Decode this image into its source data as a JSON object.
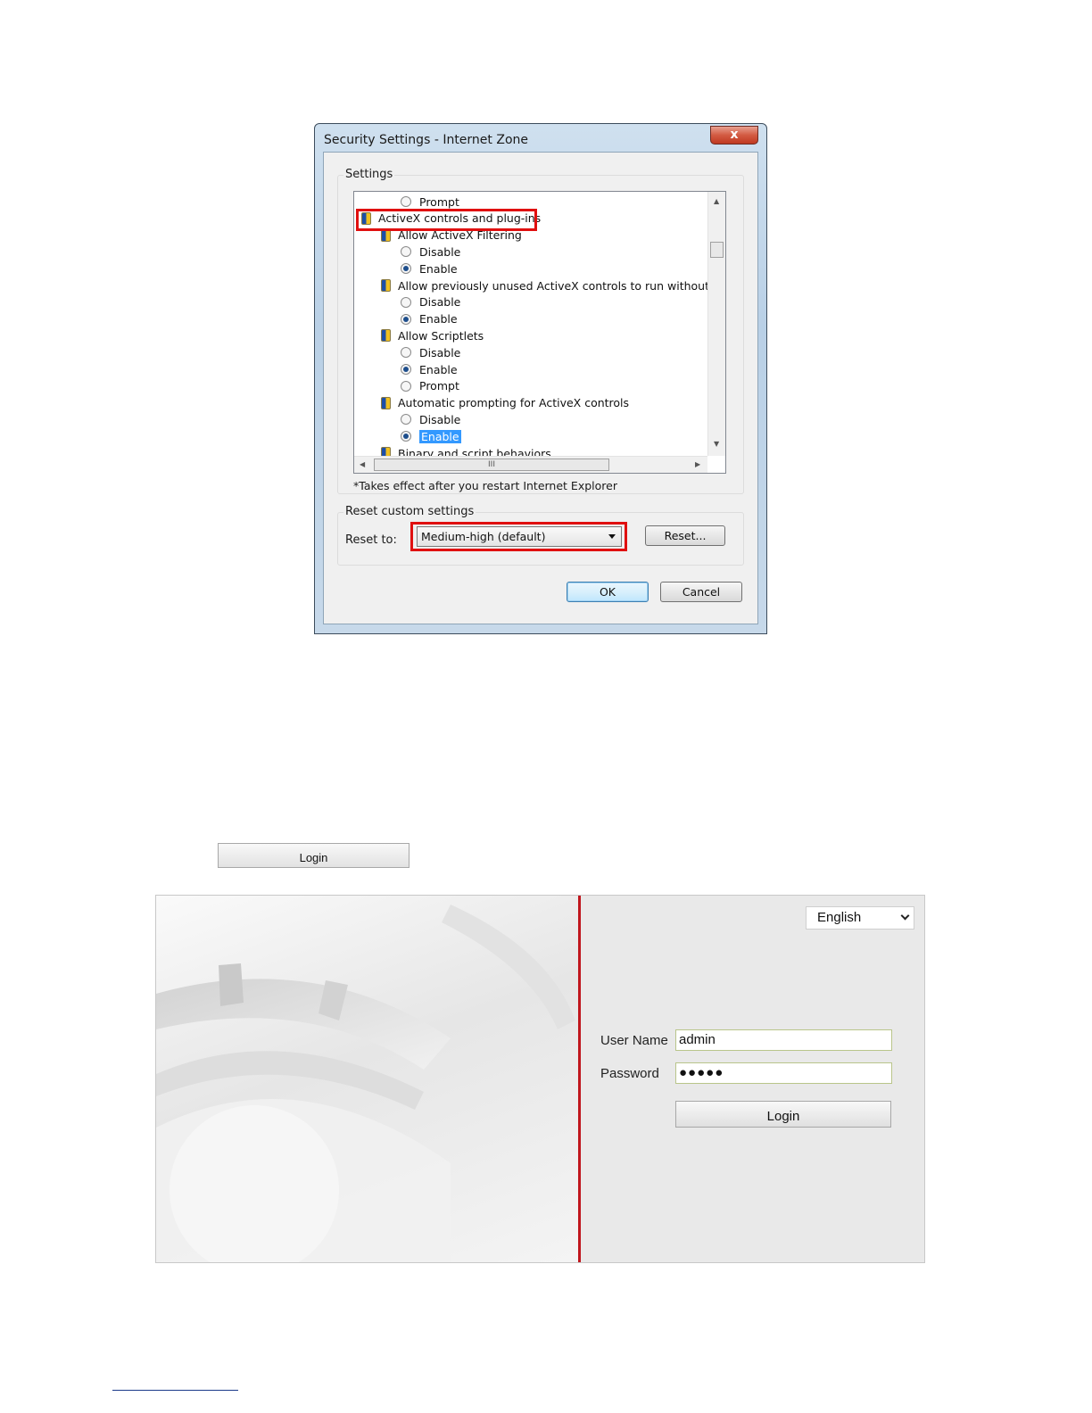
{
  "dialog": {
    "title": "Security Settings - Internet Zone",
    "close_glyph": "x",
    "settings_group_label": "Settings",
    "list_rows": [
      {
        "kind": "radio",
        "label": "Prompt",
        "checked": false
      },
      {
        "kind": "category",
        "label": "ActiveX controls and plug-ins"
      },
      {
        "kind": "setting",
        "label": "Allow ActiveX Filtering"
      },
      {
        "kind": "radio",
        "label": "Disable",
        "checked": false
      },
      {
        "kind": "radio",
        "label": "Enable",
        "checked": true
      },
      {
        "kind": "setting",
        "label": "Allow previously unused ActiveX controls to run without prom"
      },
      {
        "kind": "radio",
        "label": "Disable",
        "checked": false
      },
      {
        "kind": "radio",
        "label": "Enable",
        "checked": true
      },
      {
        "kind": "setting",
        "label": "Allow Scriptlets"
      },
      {
        "kind": "radio",
        "label": "Disable",
        "checked": false
      },
      {
        "kind": "radio",
        "label": "Enable",
        "checked": true
      },
      {
        "kind": "radio",
        "label": "Prompt",
        "checked": false
      },
      {
        "kind": "setting",
        "label": "Automatic prompting for ActiveX controls"
      },
      {
        "kind": "radio",
        "label": "Disable",
        "checked": false
      },
      {
        "kind": "radio",
        "label": "Enable",
        "checked": true,
        "selected": true
      },
      {
        "kind": "setting",
        "label": "Binary and script behaviors"
      }
    ],
    "hscroll_thumb_glyph": "III",
    "restart_note": "*Takes effect after you restart Internet Explorer",
    "reset_group_label": "Reset custom settings",
    "reset_to_label": "Reset to:",
    "reset_level": "Medium-high (default)",
    "reset_button": "Reset...",
    "ok_button": "OK",
    "cancel_button": "Cancel"
  },
  "standalone_login_button": "Login",
  "login_page": {
    "language": "English",
    "username_label": "User Name",
    "username_value": "admin",
    "password_label": "Password",
    "password_value": "●●●●●",
    "login_button": "Login",
    "accent_color": "#c0161d"
  },
  "colors": {
    "highlight_box": "#e01010",
    "selection": "#3399ff"
  }
}
